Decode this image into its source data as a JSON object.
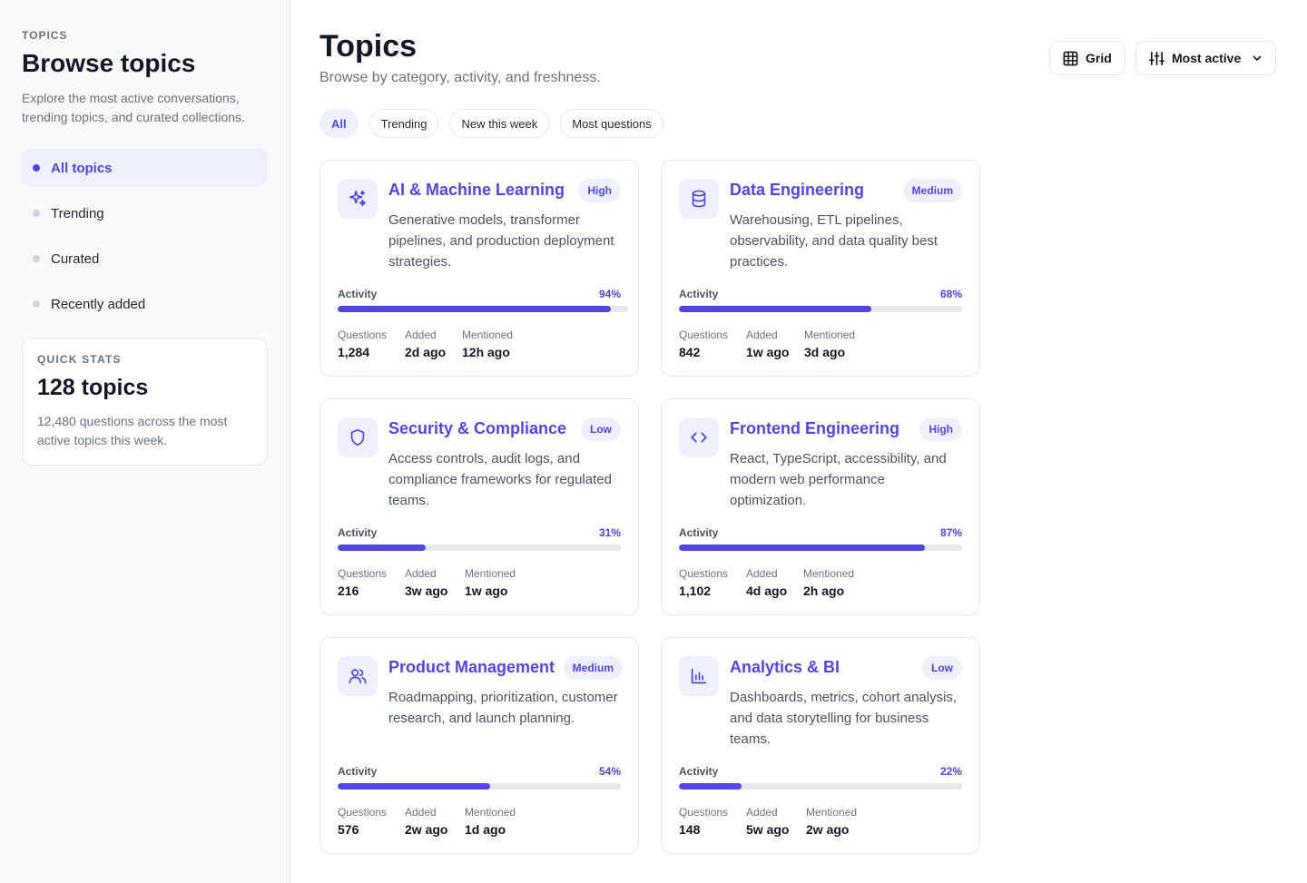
{
  "sidebar": {
    "eyebrow": "TOPICS",
    "title": "Browse topics",
    "description": "Explore the most active conversations, trending topics, and curated collections.",
    "nav": [
      {
        "label": "All topics",
        "active": true
      },
      {
        "label": "Trending",
        "active": false
      },
      {
        "label": "Curated",
        "active": false
      },
      {
        "label": "Recently added",
        "active": false
      }
    ],
    "stats": {
      "eyebrow": "QUICK STATS",
      "value": "128 topics",
      "description": "12,480 questions across the most active topics this week."
    }
  },
  "header": {
    "title": "Topics",
    "subtitle": "Browse by category, activity, and freshness.",
    "view_button": "Grid",
    "sort_button": "Most active"
  },
  "filters": [
    {
      "label": "All",
      "active": true
    },
    {
      "label": "Trending",
      "active": false
    },
    {
      "label": "New this week",
      "active": false
    },
    {
      "label": "Most questions",
      "active": false
    }
  ],
  "labels": {
    "activity": "Activity",
    "questions": "Questions",
    "added": "Added",
    "mentioned": "Mentioned"
  },
  "topics": [
    {
      "title": "AI & Machine Learning",
      "badge": "High",
      "icon": "sparkles-icon",
      "description": "Generative models, transformer pipelines, and production deployment strategies.",
      "activity": 94,
      "activity_label": "94%",
      "questions": "1,284",
      "added": "2d ago",
      "mentioned": "12h ago"
    },
    {
      "title": "Data Engineering",
      "badge": "Medium",
      "icon": "database-icon",
      "description": "Warehousing, ETL pipelines, observability, and data quality best practices.",
      "activity": 68,
      "activity_label": "68%",
      "questions": "842",
      "added": "1w ago",
      "mentioned": "3d ago"
    },
    {
      "title": "Security & Compliance",
      "badge": "Low",
      "icon": "shield-icon",
      "description": "Access controls, audit logs, and compliance frameworks for regulated teams.",
      "activity": 31,
      "activity_label": "31%",
      "questions": "216",
      "added": "3w ago",
      "mentioned": "1w ago"
    },
    {
      "title": "Frontend Engineering",
      "badge": "High",
      "icon": "code-icon",
      "description": "React, TypeScript, accessibility, and modern web performance optimization.",
      "activity": 87,
      "activity_label": "87%",
      "questions": "1,102",
      "added": "4d ago",
      "mentioned": "2h ago"
    },
    {
      "title": "Product Management",
      "badge": "Medium",
      "icon": "users-icon",
      "description": "Roadmapping, prioritization, customer research, and launch planning.",
      "activity": 54,
      "activity_label": "54%",
      "questions": "576",
      "added": "2w ago",
      "mentioned": "1d ago"
    },
    {
      "title": "Analytics & BI",
      "badge": "Low",
      "icon": "bar-chart-icon",
      "description": "Dashboards, metrics, cohort analysis, and data storytelling for business teams.",
      "activity": 22,
      "activity_label": "22%",
      "questions": "148",
      "added": "5w ago",
      "mentioned": "2w ago"
    }
  ],
  "colors": {
    "accent": "#4f46e5",
    "accent_soft": "#eef0fd",
    "track": "#e5e7eb"
  }
}
